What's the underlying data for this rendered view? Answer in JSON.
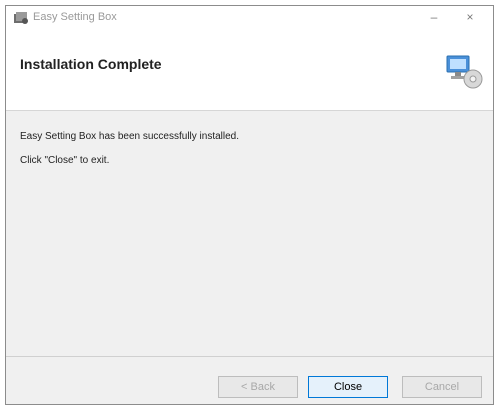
{
  "window": {
    "title": "Easy Setting Box",
    "minimize_glyph": "–",
    "close_glyph": "×"
  },
  "header": {
    "heading": "Installation Complete"
  },
  "content": {
    "message": "Easy Setting Box has been successfully installed.",
    "instruction": "Click \"Close\" to exit."
  },
  "buttons": {
    "back": "< Back",
    "close": "Close",
    "cancel": "Cancel"
  },
  "icons": {
    "app": "installer-app-icon",
    "setup": "computer-setup-icon"
  },
  "colors": {
    "focus_border": "#0078d7",
    "window_bg": "#f0f0f0"
  }
}
